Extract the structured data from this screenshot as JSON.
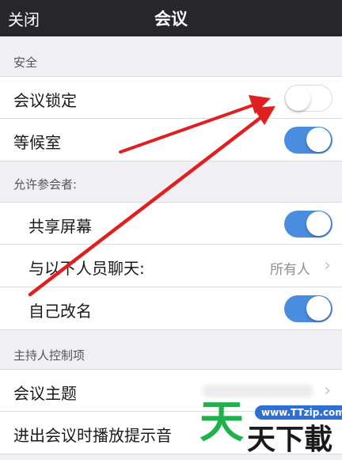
{
  "navbar": {
    "close_label": "关闭",
    "title": "会议"
  },
  "sections": {
    "security": "安全",
    "allow_participants": "允许参会者:",
    "host_controls": "主持人控制项"
  },
  "rows": {
    "meeting_lock": {
      "label": "会议锁定",
      "toggle": "off"
    },
    "waiting_room": {
      "label": "等候室",
      "toggle": "on"
    },
    "share_screen": {
      "label": "共享屏幕",
      "toggle": "on"
    },
    "chat_with": {
      "label": "与以下人员聊天:",
      "value": "所有人"
    },
    "rename_self": {
      "label": "自己改名",
      "toggle": "on"
    },
    "meeting_topic": {
      "label": "会议主题"
    },
    "join_leave_sound": {
      "label": "进出会议时播放提示音"
    }
  },
  "watermark": {
    "url": "www.TTzip.com",
    "big_char": "天",
    "text": "天下載"
  },
  "colors": {
    "toggle_on": "#4a8cdd",
    "navbar": "#27272b",
    "arrow": "#e02020"
  }
}
